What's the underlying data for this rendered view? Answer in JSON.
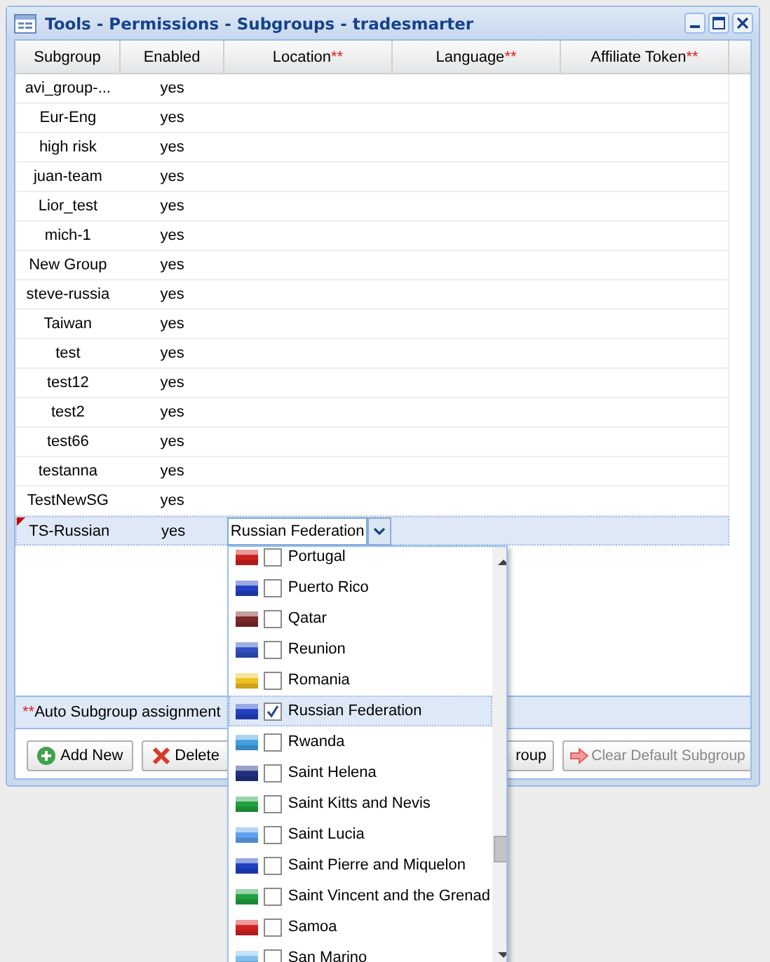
{
  "window": {
    "title": "Tools - Permissions - Subgroups - tradesmarter"
  },
  "table": {
    "columns": [
      {
        "label": "Subgroup"
      },
      {
        "label": "Enabled"
      },
      {
        "label": "Location",
        "mark": "**"
      },
      {
        "label": "Language",
        "mark": "**"
      },
      {
        "label": "Affiliate Token",
        "mark": "**"
      }
    ],
    "rows": [
      {
        "subgroup": "avi_group-...",
        "enabled": "yes",
        "selected": false,
        "modified": false
      },
      {
        "subgroup": "Eur-Eng",
        "enabled": "yes",
        "selected": false,
        "modified": false
      },
      {
        "subgroup": "high risk",
        "enabled": "yes",
        "selected": false,
        "modified": false
      },
      {
        "subgroup": "juan-team",
        "enabled": "yes",
        "selected": false,
        "modified": false
      },
      {
        "subgroup": "Lior_test",
        "enabled": "yes",
        "selected": false,
        "modified": false
      },
      {
        "subgroup": "mich-1",
        "enabled": "yes",
        "selected": false,
        "modified": false
      },
      {
        "subgroup": "New Group",
        "enabled": "yes",
        "selected": false,
        "modified": false
      },
      {
        "subgroup": "steve-russia",
        "enabled": "yes",
        "selected": false,
        "modified": false
      },
      {
        "subgroup": "Taiwan",
        "enabled": "yes",
        "selected": false,
        "modified": false
      },
      {
        "subgroup": "test",
        "enabled": "yes",
        "selected": false,
        "modified": false
      },
      {
        "subgroup": "test12",
        "enabled": "yes",
        "selected": false,
        "modified": false
      },
      {
        "subgroup": "test2",
        "enabled": "yes",
        "selected": false,
        "modified": false
      },
      {
        "subgroup": "test66",
        "enabled": "yes",
        "selected": false,
        "modified": false
      },
      {
        "subgroup": "testanna",
        "enabled": "yes",
        "selected": false,
        "modified": false
      },
      {
        "subgroup": "TestNewSG",
        "enabled": "yes",
        "selected": false,
        "modified": false
      },
      {
        "subgroup": "TS-Russian",
        "enabled": "yes",
        "selected": true,
        "modified": true,
        "location_editor": {
          "value": "Russian Federation"
        }
      }
    ]
  },
  "location_dropdown": {
    "items": [
      {
        "label": "Portugal",
        "checked": false,
        "selected": false,
        "color": "#cc2020"
      },
      {
        "label": "Puerto Rico",
        "checked": false,
        "selected": false,
        "color": "#2040c0"
      },
      {
        "label": "Qatar",
        "checked": false,
        "selected": false,
        "color": "#7a2a2a"
      },
      {
        "label": "Reunion",
        "checked": false,
        "selected": false,
        "color": "#3050c0"
      },
      {
        "label": "Romania",
        "checked": false,
        "selected": false,
        "color": "#f0c020"
      },
      {
        "label": "Russian Federation",
        "checked": true,
        "selected": true,
        "color": "#2040c0"
      },
      {
        "label": "Rwanda",
        "checked": false,
        "selected": false,
        "color": "#40a0e0"
      },
      {
        "label": "Saint Helena",
        "checked": false,
        "selected": false,
        "color": "#203080"
      },
      {
        "label": "Saint Kitts and Nevis",
        "checked": false,
        "selected": false,
        "color": "#20a040"
      },
      {
        "label": "Saint Lucia",
        "checked": false,
        "selected": false,
        "color": "#60a0f0"
      },
      {
        "label": "Saint Pierre and Miquelon",
        "checked": false,
        "selected": false,
        "color": "#2040c0"
      },
      {
        "label": "Saint Vincent and the Grenad",
        "checked": false,
        "selected": false,
        "color": "#20a040"
      },
      {
        "label": "Samoa",
        "checked": false,
        "selected": false,
        "color": "#d02020"
      },
      {
        "label": "San Marino",
        "checked": false,
        "selected": false,
        "color": "#80c0f0"
      }
    ]
  },
  "footer_note": {
    "mark": "**",
    "text": "Auto Subgroup assignment"
  },
  "buttons": [
    {
      "label": "Add New",
      "kind": "add",
      "disabled": false
    },
    {
      "label": "Delete",
      "kind": "delete",
      "disabled": false
    },
    {
      "label": "roup",
      "kind": "plain",
      "disabled": false
    },
    {
      "label": "Clear Default Subgroup",
      "kind": "clear",
      "disabled": true
    }
  ]
}
